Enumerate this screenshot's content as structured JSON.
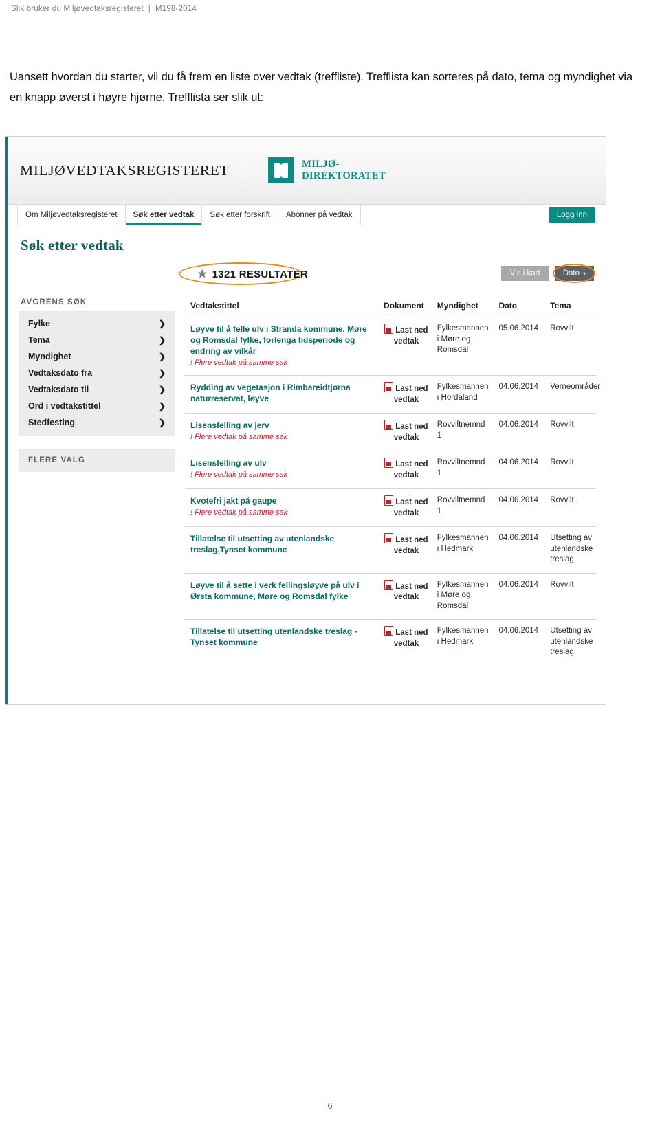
{
  "running_head": {
    "title": "Slik bruker du Miljøvedtaksregisteret",
    "separator": "|",
    "doc_id": "M198-2014"
  },
  "intro_paragraph": "Uansett hvordan du starter, vil du få frem en liste over vedtak (treffliste). Trefflista kan sorteres på dato, tema og myndighet via en knapp øverst i høyre hjørne. Trefflista ser slik ut:",
  "screenshot": {
    "masthead": {
      "wordmark": "MILJØVEDTAKSREGISTERET",
      "agency_line1": "MILJØ-",
      "agency_line2": "DIREKTORATET"
    },
    "nav": {
      "tabs": [
        {
          "label": "Om Miljøvedtaksregisteret",
          "active": false
        },
        {
          "label": "Søk etter vedtak",
          "active": true
        },
        {
          "label": "Søk etter forskrift",
          "active": false
        },
        {
          "label": "Abonner på vedtak",
          "active": false
        }
      ],
      "login_label": "Logg inn"
    },
    "page_title": "Søk etter vedtak",
    "toolbar": {
      "result_count": "1321 RESULTATER",
      "map_button": "Vis i kart",
      "sort_button": "Dato",
      "sort_caret": "▾"
    },
    "sidebar": {
      "heading": "AVGRENS SØK",
      "filters": [
        {
          "label": "Fylke"
        },
        {
          "label": "Tema"
        },
        {
          "label": "Myndighet"
        },
        {
          "label": "Vedtaksdato fra"
        },
        {
          "label": "Vedtaksdato til"
        },
        {
          "label": "Ord i vedtakstittel"
        },
        {
          "label": "Stedfesting"
        }
      ],
      "chevron": "❯",
      "more_options": "FLERE VALG"
    },
    "table": {
      "headers": [
        "Vedtakstittel",
        "Dokument",
        "Myndighet",
        "Dato",
        "Tema"
      ],
      "document_label": "Last ned vedtak",
      "multi_note": "! Flere vedtak på samme sak",
      "rows": [
        {
          "title": "Løyve til å felle ulv i Stranda kommune, Møre og Romsdal fylke, forlenga tidsperiode og endring av vilkår",
          "multi": true,
          "authority": "Fylkesmannen i Møre og Romsdal",
          "date": "05.06.2014",
          "theme": "Rovvilt"
        },
        {
          "title": "Rydding av vegetasjon i Rimbareidtjørna naturreservat, løyve",
          "multi": false,
          "authority": "Fylkesmannen i Hordaland",
          "date": "04.06.2014",
          "theme": "Verneområder"
        },
        {
          "title": "Lisensfelling av jerv",
          "multi": true,
          "authority": "Rovviltnemnd 1",
          "date": "04.06.2014",
          "theme": "Rovvilt"
        },
        {
          "title": "Lisensfelling av ulv",
          "multi": true,
          "authority": "Rovviltnemnd 1",
          "date": "04.06.2014",
          "theme": "Rovvilt"
        },
        {
          "title": "Kvotefri jakt på gaupe",
          "multi": true,
          "authority": "Rovviltnemnd 1",
          "date": "04.06.2014",
          "theme": "Rovvilt"
        },
        {
          "title": "Tillatelse til utsetting av utenlandske treslag,Tynset kommune",
          "multi": false,
          "authority": "Fylkesmannen i Hedmark",
          "date": "04.06.2014",
          "theme": "Utsetting av utenlandske treslag"
        },
        {
          "title": "Løyve til å sette i verk fellingsløyve på ulv i Ørsta kommune, Møre og Romsdal fylke",
          "multi": false,
          "authority": "Fylkesmannen i Møre og Romsdal",
          "date": "04.06.2014",
          "theme": "Rovvilt"
        },
        {
          "title": "Tillatelse til utsetting utenlandske treslag - Tynset kommune",
          "multi": false,
          "authority": "Fylkesmannen i Hedmark",
          "date": "04.06.2014",
          "theme": "Utsetting av utenlandske treslag"
        }
      ]
    }
  },
  "folio": "6",
  "colors": {
    "teal": "#0b8b82",
    "teal_dark": "#0e5f5b",
    "link_teal": "#0e6a63",
    "orange_ring": "#e08a1e",
    "red_note": "#c0272d",
    "grey_button": "#a7a9ab",
    "dark_button": "#5f6264"
  }
}
